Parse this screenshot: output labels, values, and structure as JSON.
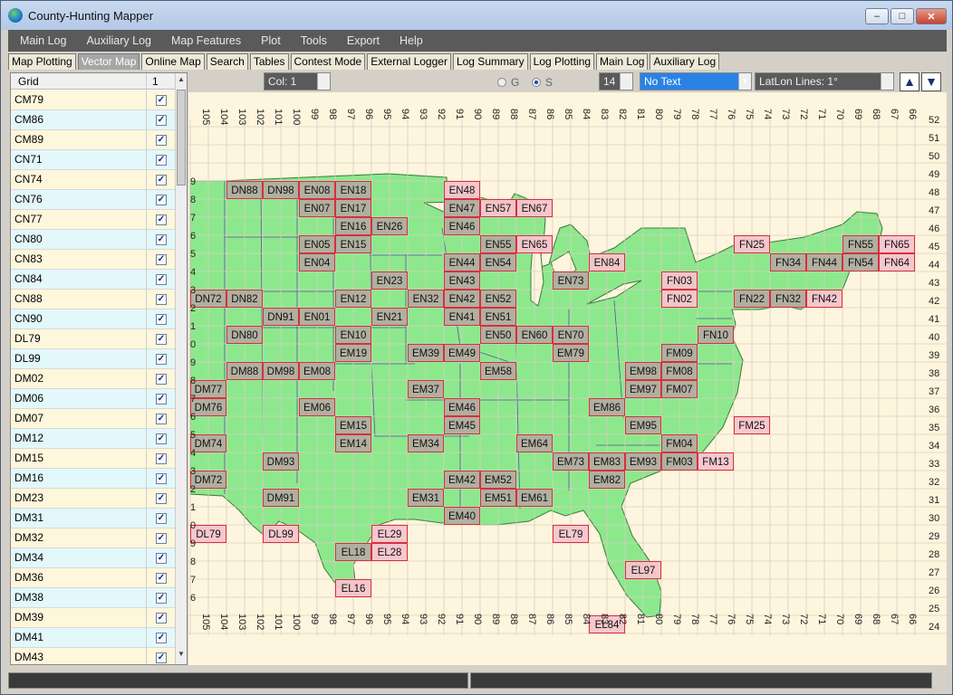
{
  "title": "County-Hunting Mapper",
  "window_buttons": [
    "–",
    "□",
    "✕"
  ],
  "menu": [
    "Main Log",
    "Auxiliary Log",
    "Map Features",
    "Plot",
    "Tools",
    "Export",
    "Help"
  ],
  "tabs": [
    {
      "label": "Map Plotting",
      "active": false
    },
    {
      "label": "Vector Map",
      "active": true
    },
    {
      "label": "Online Map",
      "active": false
    },
    {
      "label": "Search",
      "active": false
    },
    {
      "label": "Tables",
      "active": false
    },
    {
      "label": "Contest Mode",
      "active": false
    },
    {
      "label": "External Logger",
      "active": false
    },
    {
      "label": "Log Summary",
      "active": false
    },
    {
      "label": "Log Plotting",
      "active": false
    },
    {
      "label": "Main Log",
      "active": false
    },
    {
      "label": "Auxiliary Log",
      "active": false
    }
  ],
  "grid_list": {
    "header_col1": "Grid",
    "header_col2": "1",
    "rows": [
      "CM79",
      "CM86",
      "CM89",
      "CN71",
      "CN74",
      "CN76",
      "CN77",
      "CN80",
      "CN83",
      "CN84",
      "CN88",
      "CN90",
      "DL79",
      "DL99",
      "DM02",
      "DM06",
      "DM07",
      "DM12",
      "DM15",
      "DM16",
      "DM23",
      "DM31",
      "DM32",
      "DM34",
      "DM36",
      "DM38",
      "DM39",
      "DM41",
      "DM43"
    ],
    "check_glyph": "✓"
  },
  "controls": {
    "col_combo": "Col: 1",
    "radio_g": "G",
    "radio_s": "S",
    "radio_selected": "S",
    "size_combo": "14",
    "text_combo": "No Text",
    "latlon_combo": "LatLon Lines: 1°",
    "up_arrow": "▲",
    "down_arrow": "▼"
  },
  "map": {
    "lon_labels": [
      "105",
      "104",
      "103",
      "102",
      "101",
      "100",
      "99",
      "98",
      "97",
      "96",
      "95",
      "94",
      "93",
      "92",
      "91",
      "90",
      "89",
      "88",
      "87",
      "86",
      "85",
      "84",
      "83",
      "82",
      "81",
      "80",
      "79",
      "78",
      "77",
      "76",
      "75",
      "74",
      "73",
      "72",
      "71",
      "70",
      "69",
      "68",
      "67",
      "66"
    ],
    "lat_labels": [
      "52",
      "51",
      "50",
      "49",
      "48",
      "47",
      "46",
      "45",
      "44",
      "43",
      "42",
      "41",
      "40",
      "39",
      "38",
      "37",
      "36",
      "35",
      "34",
      "33",
      "32",
      "31",
      "30",
      "29",
      "28",
      "27",
      "26",
      "25",
      "24"
    ],
    "left_lat_digits": [
      "9",
      "8",
      "7",
      "6",
      "5",
      "4",
      "3",
      "2",
      "1",
      "0",
      "9",
      "8",
      "7",
      "6",
      "5",
      "4",
      "3",
      "2",
      "1",
      "0",
      "9",
      "8",
      "7",
      "6"
    ],
    "grids": [
      {
        "label": "DN88",
        "state": "gray",
        "col": 2,
        "row": 0
      },
      {
        "label": "DN98",
        "state": "gray",
        "col": 4,
        "row": 0
      },
      {
        "label": "EN08",
        "state": "gray",
        "col": 6,
        "row": 0
      },
      {
        "label": "EN18",
        "state": "gray",
        "col": 8,
        "row": 0
      },
      {
        "label": "EN48",
        "state": "pink",
        "col": 14,
        "row": 0
      },
      {
        "label": "EN07",
        "state": "gray",
        "col": 6,
        "row": 1
      },
      {
        "label": "EN17",
        "state": "gray",
        "col": 8,
        "row": 1
      },
      {
        "label": "EN47",
        "state": "gray",
        "col": 14,
        "row": 1
      },
      {
        "label": "EN57",
        "state": "pink",
        "col": 16,
        "row": 1
      },
      {
        "label": "EN67",
        "state": "pink",
        "col": 18,
        "row": 1
      },
      {
        "label": "EN16",
        "state": "gray",
        "col": 8,
        "row": 2
      },
      {
        "label": "EN26",
        "state": "gray",
        "col": 10,
        "row": 2
      },
      {
        "label": "EN46",
        "state": "gray",
        "col": 14,
        "row": 2
      },
      {
        "label": "EN05",
        "state": "gray",
        "col": 6,
        "row": 3
      },
      {
        "label": "EN15",
        "state": "gray",
        "col": 8,
        "row": 3
      },
      {
        "label": "EN55",
        "state": "gray",
        "col": 16,
        "row": 3
      },
      {
        "label": "EN65",
        "state": "pink",
        "col": 18,
        "row": 3
      },
      {
        "label": "FN25",
        "state": "pink",
        "col": 30,
        "row": 3
      },
      {
        "label": "FN55",
        "state": "gray",
        "col": 36,
        "row": 3
      },
      {
        "label": "FN65",
        "state": "pink",
        "col": 38,
        "row": 3
      },
      {
        "label": "EN04",
        "state": "gray",
        "col": 6,
        "row": 4
      },
      {
        "label": "EN44",
        "state": "gray",
        "col": 14,
        "row": 4
      },
      {
        "label": "EN54",
        "state": "gray",
        "col": 16,
        "row": 4
      },
      {
        "label": "EN84",
        "state": "pink",
        "col": 22,
        "row": 4
      },
      {
        "label": "FN34",
        "state": "gray",
        "col": 32,
        "row": 4
      },
      {
        "label": "FN44",
        "state": "gray",
        "col": 34,
        "row": 4
      },
      {
        "label": "FN54",
        "state": "gray",
        "col": 36,
        "row": 4
      },
      {
        "label": "FN64",
        "state": "pink",
        "col": 38,
        "row": 4
      },
      {
        "label": "EN23",
        "state": "gray",
        "col": 10,
        "row": 5
      },
      {
        "label": "EN43",
        "state": "gray",
        "col": 14,
        "row": 5
      },
      {
        "label": "EN73",
        "state": "gray",
        "col": 20,
        "row": 5
      },
      {
        "label": "FN03",
        "state": "pink",
        "col": 26,
        "row": 5
      },
      {
        "label": "DN72",
        "state": "gray",
        "col": 0,
        "row": 6
      },
      {
        "label": "DN82",
        "state": "gray",
        "col": 2,
        "row": 6
      },
      {
        "label": "EN12",
        "state": "gray",
        "col": 8,
        "row": 6
      },
      {
        "label": "EN32",
        "state": "gray",
        "col": 12,
        "row": 6
      },
      {
        "label": "EN42",
        "state": "gray",
        "col": 14,
        "row": 6
      },
      {
        "label": "EN52",
        "state": "gray",
        "col": 16,
        "row": 6
      },
      {
        "label": "FN02",
        "state": "pink",
        "col": 26,
        "row": 6
      },
      {
        "label": "FN22",
        "state": "gray",
        "col": 30,
        "row": 6
      },
      {
        "label": "FN32",
        "state": "gray",
        "col": 32,
        "row": 6
      },
      {
        "label": "FN42",
        "state": "pink",
        "col": 34,
        "row": 6
      },
      {
        "label": "DN91",
        "state": "gray",
        "col": 4,
        "row": 7
      },
      {
        "label": "EN01",
        "state": "gray",
        "col": 6,
        "row": 7
      },
      {
        "label": "EN21",
        "state": "gray",
        "col": 10,
        "row": 7
      },
      {
        "label": "EN41",
        "state": "gray",
        "col": 14,
        "row": 7
      },
      {
        "label": "EN51",
        "state": "gray",
        "col": 16,
        "row": 7
      },
      {
        "label": "DN80",
        "state": "gray",
        "col": 2,
        "row": 8
      },
      {
        "label": "EN10",
        "state": "gray",
        "col": 8,
        "row": 8
      },
      {
        "label": "EN50",
        "state": "gray",
        "col": 16,
        "row": 8
      },
      {
        "label": "EN60",
        "state": "gray",
        "col": 18,
        "row": 8
      },
      {
        "label": "EN70",
        "state": "gray",
        "col": 20,
        "row": 8
      },
      {
        "label": "FN10",
        "state": "gray",
        "col": 28,
        "row": 8
      },
      {
        "label": "EM19",
        "state": "gray",
        "col": 8,
        "row": 9
      },
      {
        "label": "EM39",
        "state": "gray",
        "col": 12,
        "row": 9
      },
      {
        "label": "EM49",
        "state": "gray",
        "col": 14,
        "row": 9
      },
      {
        "label": "EM79",
        "state": "gray",
        "col": 20,
        "row": 9
      },
      {
        "label": "FM09",
        "state": "gray",
        "col": 26,
        "row": 9
      },
      {
        "label": "DM88",
        "state": "gray",
        "col": 2,
        "row": 10
      },
      {
        "label": "DM98",
        "state": "gray",
        "col": 4,
        "row": 10
      },
      {
        "label": "EM08",
        "state": "gray",
        "col": 6,
        "row": 10
      },
      {
        "label": "EM58",
        "state": "gray",
        "col": 16,
        "row": 10
      },
      {
        "label": "EM98",
        "state": "gray",
        "col": 24,
        "row": 10
      },
      {
        "label": "FM08",
        "state": "gray",
        "col": 26,
        "row": 10
      },
      {
        "label": "DM77",
        "state": "gray",
        "col": 0,
        "row": 11
      },
      {
        "label": "EM37",
        "state": "gray",
        "col": 12,
        "row": 11
      },
      {
        "label": "EM97",
        "state": "gray",
        "col": 24,
        "row": 11
      },
      {
        "label": "FM07",
        "state": "gray",
        "col": 26,
        "row": 11
      },
      {
        "label": "DM76",
        "state": "gray",
        "col": 0,
        "row": 12
      },
      {
        "label": "EM06",
        "state": "gray",
        "col": 6,
        "row": 12
      },
      {
        "label": "EM46",
        "state": "gray",
        "col": 14,
        "row": 12
      },
      {
        "label": "EM86",
        "state": "gray",
        "col": 22,
        "row": 12
      },
      {
        "label": "EM15",
        "state": "gray",
        "col": 8,
        "row": 13
      },
      {
        "label": "EM45",
        "state": "gray",
        "col": 14,
        "row": 13
      },
      {
        "label": "EM95",
        "state": "gray",
        "col": 24,
        "row": 13
      },
      {
        "label": "FM25",
        "state": "pink",
        "col": 30,
        "row": 13
      },
      {
        "label": "DM74",
        "state": "gray",
        "col": 0,
        "row": 14
      },
      {
        "label": "EM14",
        "state": "gray",
        "col": 8,
        "row": 14
      },
      {
        "label": "EM34",
        "state": "gray",
        "col": 12,
        "row": 14
      },
      {
        "label": "EM64",
        "state": "gray",
        "col": 18,
        "row": 14
      },
      {
        "label": "FM04",
        "state": "gray",
        "col": 26,
        "row": 14
      },
      {
        "label": "DM93",
        "state": "gray",
        "col": 4,
        "row": 15
      },
      {
        "label": "EM73",
        "state": "gray",
        "col": 20,
        "row": 15
      },
      {
        "label": "EM83",
        "state": "gray",
        "col": 22,
        "row": 15
      },
      {
        "label": "EM93",
        "state": "gray",
        "col": 24,
        "row": 15
      },
      {
        "label": "FM03",
        "state": "gray",
        "col": 26,
        "row": 15
      },
      {
        "label": "FM13",
        "state": "pink",
        "col": 28,
        "row": 15
      },
      {
        "label": "DM72",
        "state": "gray",
        "col": 0,
        "row": 16
      },
      {
        "label": "EM42",
        "state": "gray",
        "col": 14,
        "row": 16
      },
      {
        "label": "EM52",
        "state": "gray",
        "col": 16,
        "row": 16
      },
      {
        "label": "EM82",
        "state": "gray",
        "col": 22,
        "row": 16
      },
      {
        "label": "DM91",
        "state": "gray",
        "col": 4,
        "row": 17
      },
      {
        "label": "EM31",
        "state": "gray",
        "col": 12,
        "row": 17
      },
      {
        "label": "EM51",
        "state": "gray",
        "col": 16,
        "row": 17
      },
      {
        "label": "EM61",
        "state": "gray",
        "col": 18,
        "row": 17
      },
      {
        "label": "EM40",
        "state": "gray",
        "col": 14,
        "row": 18
      },
      {
        "label": "DL79",
        "state": "pink",
        "col": 0,
        "row": 19
      },
      {
        "label": "DL99",
        "state": "pink",
        "col": 4,
        "row": 19
      },
      {
        "label": "EL29",
        "state": "pink",
        "col": 10,
        "row": 19
      },
      {
        "label": "EL79",
        "state": "pink",
        "col": 20,
        "row": 19
      },
      {
        "label": "EL18",
        "state": "gray",
        "col": 8,
        "row": 20
      },
      {
        "label": "EL28",
        "state": "pink",
        "col": 10,
        "row": 20
      },
      {
        "label": "EL97",
        "state": "pink",
        "col": 24,
        "row": 21
      },
      {
        "label": "EL16",
        "state": "pink",
        "col": 8,
        "row": 22
      },
      {
        "label": "EL84",
        "state": "pink",
        "col": 22,
        "row": 24
      }
    ]
  },
  "colors": {
    "land": "#8de88d",
    "ocean": "#fdf5dd",
    "grid_gray": "#b3aca1",
    "grid_pink": "#f7c4cc",
    "grid_border": "#d4313d",
    "latlon_line": "#d8d0c0",
    "state_border": "#4a5a9a"
  }
}
